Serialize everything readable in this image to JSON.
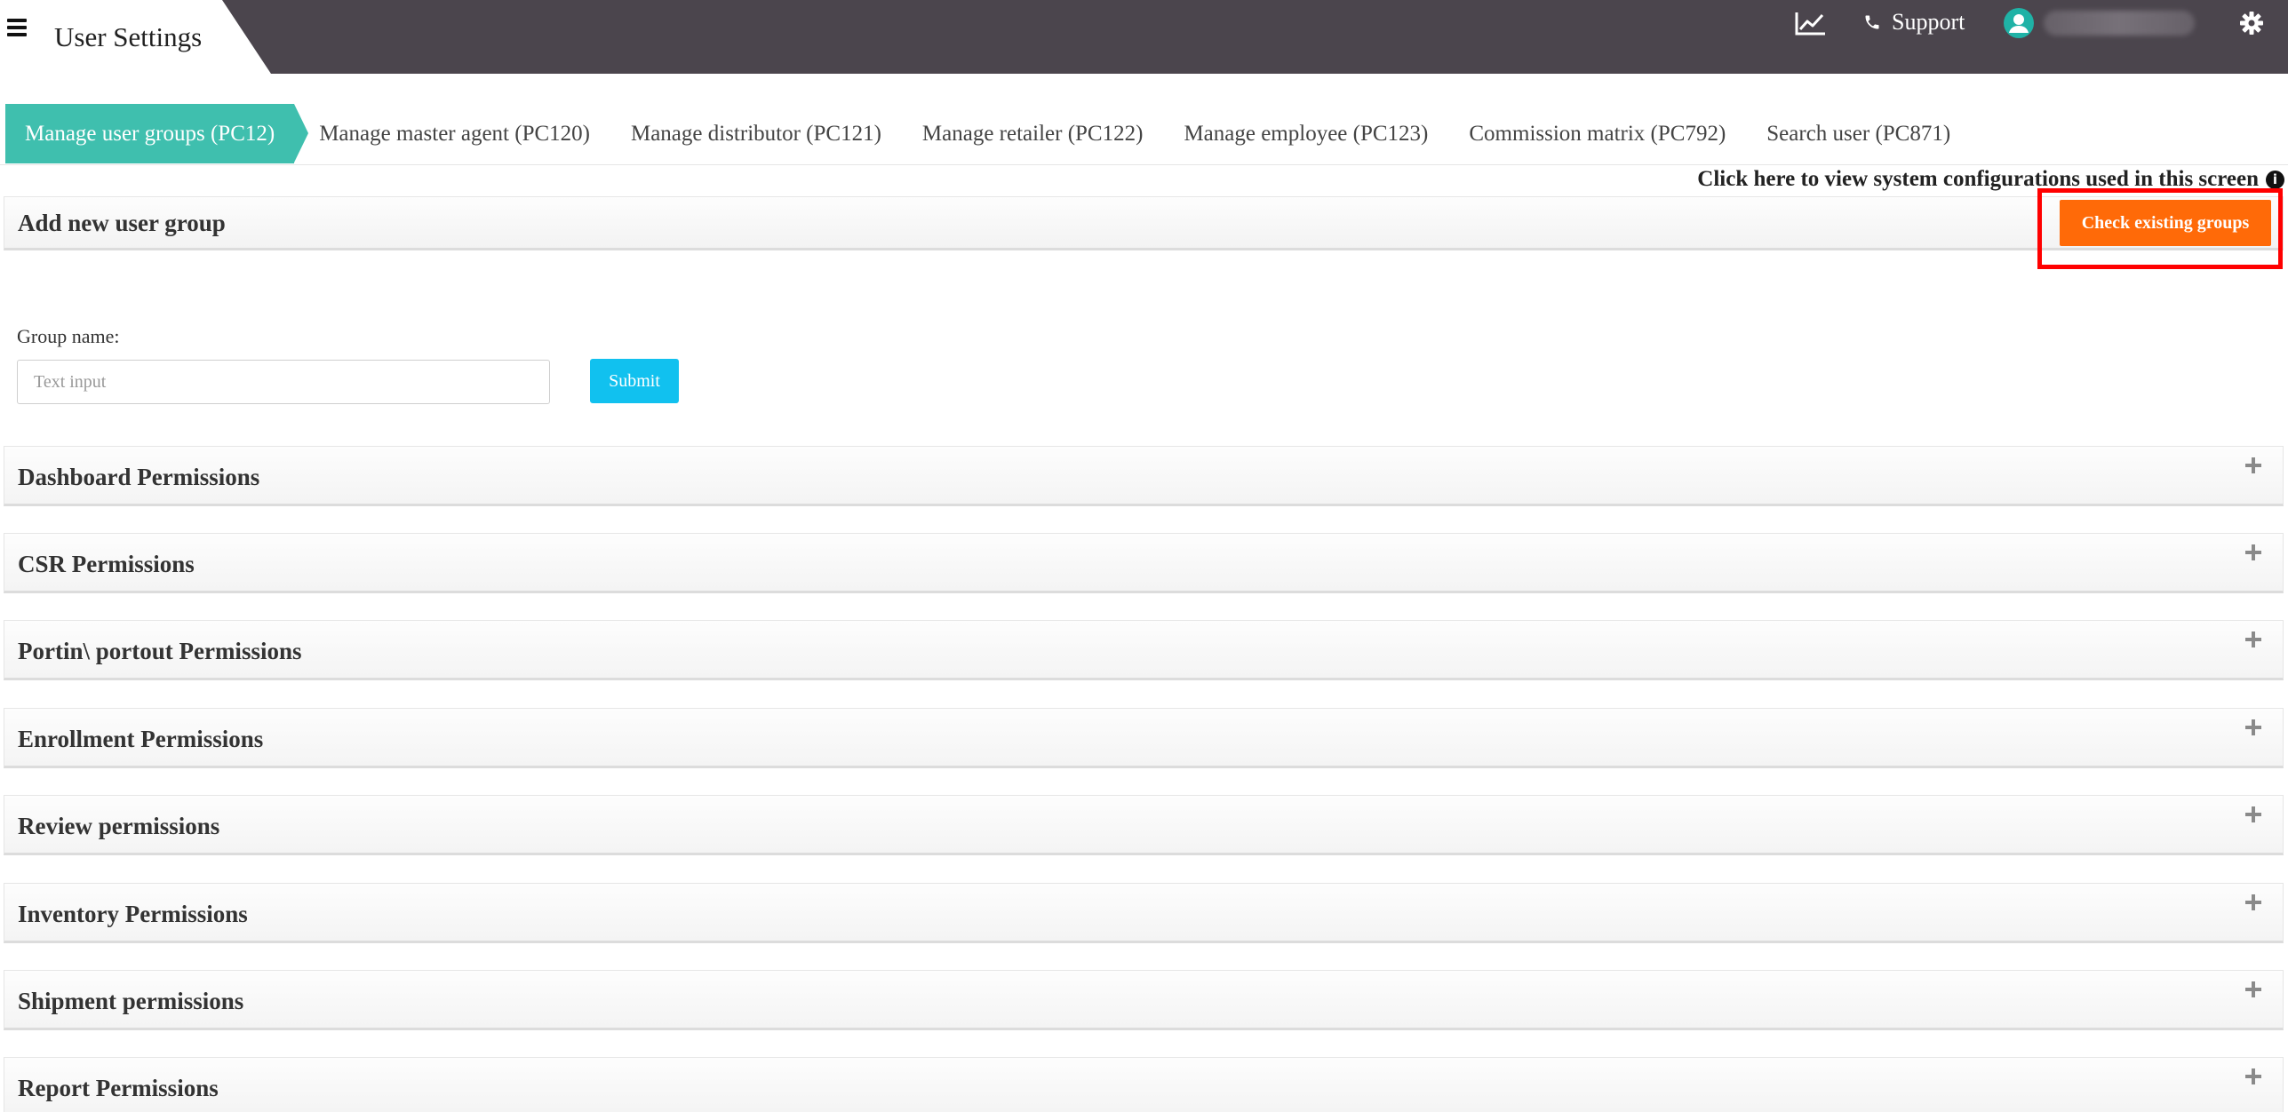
{
  "header": {
    "title": "User Settings",
    "support_label": "Support",
    "background": "#4b454d"
  },
  "tabs": [
    {
      "label": "Manage user groups (PC12)",
      "active": true
    },
    {
      "label": "Manage master agent (PC120)"
    },
    {
      "label": "Manage distributor (PC121)"
    },
    {
      "label": "Manage retailer (PC122)"
    },
    {
      "label": "Manage employee (PC123)"
    },
    {
      "label": "Commission matrix (PC792)"
    },
    {
      "label": "Search user (PC871)"
    }
  ],
  "config_link": "Click here to view system configurations used in this screen",
  "add_group": {
    "title": "Add new user group",
    "check_button": "Check existing groups",
    "group_name_label": "Group name:",
    "input_placeholder": "Text input",
    "input_value": "",
    "submit_label": "Submit"
  },
  "permissions": [
    {
      "label": "Dashboard Permissions"
    },
    {
      "label": "CSR Permissions"
    },
    {
      "label": "Portin\\ portout Permissions"
    },
    {
      "label": "Enrollment Permissions"
    },
    {
      "label": "Review permissions"
    },
    {
      "label": "Inventory Permissions"
    },
    {
      "label": "Shipment permissions"
    },
    {
      "label": "Report Permissions"
    }
  ],
  "colors": {
    "tab_active": "#3fbfae",
    "check_button": "#ff6a08",
    "submit_button": "#11c1ef",
    "highlight": "#ff0000",
    "avatar": "#1fb2a6"
  },
  "icons": [
    "hamburger-menu-icon",
    "line-chart-icon",
    "phone-icon",
    "user-avatar-icon",
    "gear-icon",
    "info-icon",
    "plus-icon"
  ]
}
